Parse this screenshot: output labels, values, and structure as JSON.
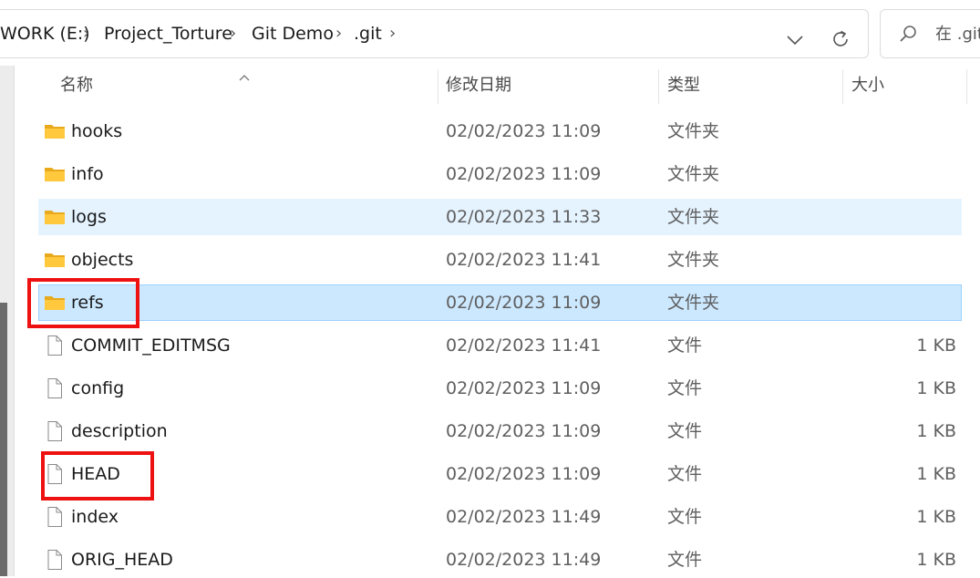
{
  "breadcrumb": {
    "items": [
      "WORK (E:)",
      "Project_Torture",
      "Git Demo",
      ".git"
    ],
    "separator": "›"
  },
  "search": {
    "placeholder": "在 .git"
  },
  "columns": {
    "name": "名称",
    "date": "修改日期",
    "type": "类型",
    "size": "大小"
  },
  "files": [
    {
      "name": "hooks",
      "date": "02/02/2023 11:09",
      "type": "文件夹",
      "size": "",
      "icon": "folder-icon"
    },
    {
      "name": "info",
      "date": "02/02/2023 11:09",
      "type": "文件夹",
      "size": "",
      "icon": "folder-icon"
    },
    {
      "name": "logs",
      "date": "02/02/2023 11:33",
      "type": "文件夹",
      "size": "",
      "icon": "folder-icon",
      "state": "hover"
    },
    {
      "name": "objects",
      "date": "02/02/2023 11:41",
      "type": "文件夹",
      "size": "",
      "icon": "folder-icon"
    },
    {
      "name": "refs",
      "date": "02/02/2023 11:09",
      "type": "文件夹",
      "size": "",
      "icon": "folder-icon",
      "state": "selected"
    },
    {
      "name": "COMMIT_EDITMSG",
      "date": "02/02/2023 11:41",
      "type": "文件",
      "size": "1 KB",
      "icon": "file-icon"
    },
    {
      "name": "config",
      "date": "02/02/2023 11:09",
      "type": "文件",
      "size": "1 KB",
      "icon": "file-icon"
    },
    {
      "name": "description",
      "date": "02/02/2023 11:09",
      "type": "文件",
      "size": "1 KB",
      "icon": "file-icon"
    },
    {
      "name": "HEAD",
      "date": "02/02/2023 11:09",
      "type": "文件",
      "size": "1 KB",
      "icon": "file-icon"
    },
    {
      "name": "index",
      "date": "02/02/2023 11:49",
      "type": "文件",
      "size": "1 KB",
      "icon": "file-icon"
    },
    {
      "name": "ORIG_HEAD",
      "date": "02/02/2023 11:49",
      "type": "文件",
      "size": "1 KB",
      "icon": "file-icon"
    }
  ],
  "colors": {
    "hover": "#e5f3ff",
    "selected": "#cce8ff",
    "folder": "#ffc83d",
    "annotation": "#ee1111"
  }
}
